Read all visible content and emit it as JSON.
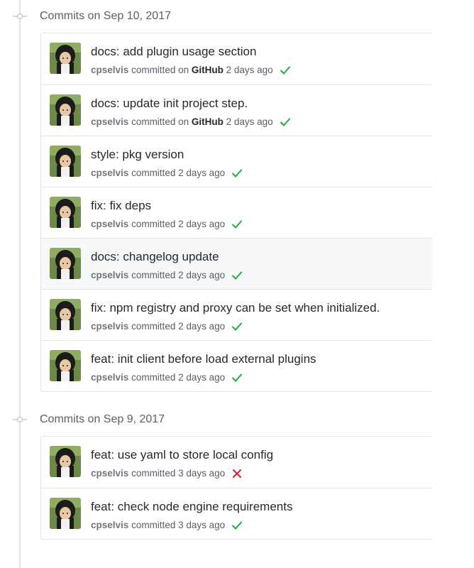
{
  "groups": [
    {
      "header": "Commits on Sep 10, 2017",
      "commits": [
        {
          "title": "docs: add plugin usage section",
          "author": "cpselvis",
          "committed": "committed on",
          "via": "GitHub",
          "time": "2 days ago",
          "status": "success"
        },
        {
          "title": "docs: update init project step.",
          "author": "cpselvis",
          "committed": "committed on",
          "via": "GitHub",
          "time": "2 days ago",
          "status": "success"
        },
        {
          "title": "style: pkg version",
          "author": "cpselvis",
          "committed": "committed",
          "via": "",
          "time": "2 days ago",
          "status": "success"
        },
        {
          "title": "fix: fix deps",
          "author": "cpselvis",
          "committed": "committed",
          "via": "",
          "time": "2 days ago",
          "status": "success"
        },
        {
          "title": "docs: changelog update",
          "author": "cpselvis",
          "committed": "committed",
          "via": "",
          "time": "2 days ago",
          "status": "success"
        },
        {
          "title": "fix: npm registry and proxy can be set when initialized.",
          "author": "cpselvis",
          "committed": "committed",
          "via": "",
          "time": "2 days ago",
          "status": "success"
        },
        {
          "title": "feat: init client before load external plugins",
          "author": "cpselvis",
          "committed": "committed",
          "via": "",
          "time": "2 days ago",
          "status": "success"
        }
      ]
    },
    {
      "header": "Commits on Sep 9, 2017",
      "commits": [
        {
          "title": "feat: use yaml to store local config",
          "author": "cpselvis",
          "committed": "committed",
          "via": "",
          "time": "3 days ago",
          "status": "failure"
        },
        {
          "title": "feat: check node engine requirements",
          "author": "cpselvis",
          "committed": "committed",
          "via": "",
          "time": "3 days ago",
          "status": "success"
        }
      ]
    }
  ],
  "colors": {
    "success": "#28a745",
    "failure": "#cb2431",
    "border": "#e1e4e8",
    "muted": "#586069"
  }
}
